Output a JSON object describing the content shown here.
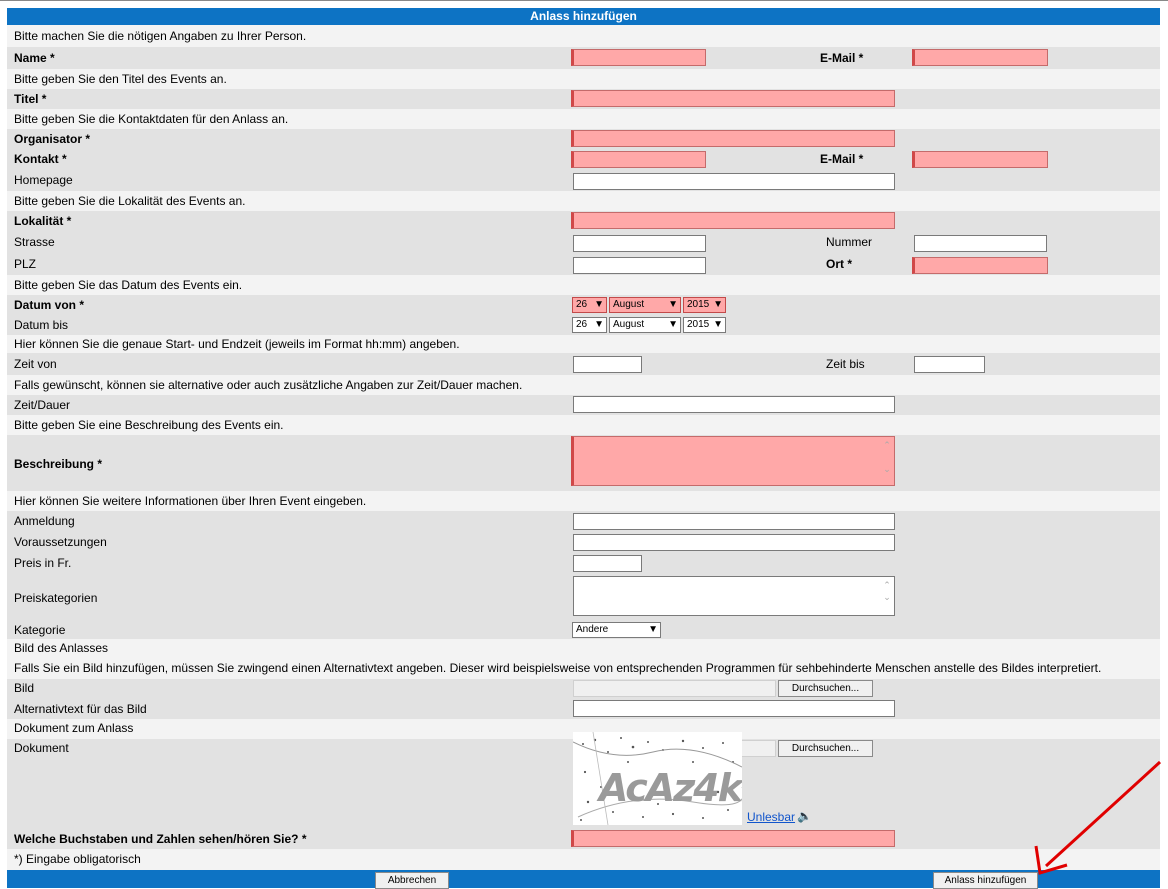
{
  "form": {
    "title": "Anlass hinzufügen",
    "rows": {
      "intro_person": "Bitte machen Sie die nötigen Angaben zu Ihrer Person.",
      "name": "Name *",
      "email1": "E-Mail *",
      "intro_title": "Bitte geben Sie den Titel des Events an.",
      "titel": "Titel *",
      "intro_contact": "Bitte geben Sie die Kontaktdaten für den Anlass an.",
      "organisator": "Organisator *",
      "kontakt": "Kontakt *",
      "email2": "E-Mail *",
      "homepage": "Homepage",
      "intro_location": "Bitte geben Sie die Lokalität des Events an.",
      "lokalitaet": "Lokalität *",
      "strasse": "Strasse",
      "nummer": "Nummer",
      "plz": "PLZ",
      "ort": "Ort *",
      "intro_date": "Bitte geben Sie das Datum des Events ein.",
      "datum_von": "Datum von *",
      "datum_bis": "Datum bis",
      "intro_time": "Hier können Sie die genaue Start- und Endzeit (jeweils im Format hh:mm) angeben.",
      "zeit_von": "Zeit von",
      "zeit_bis": "Zeit bis",
      "intro_duration": "Falls gewünscht, können sie alternative oder auch zusätzliche Angaben zur Zeit/Dauer machen.",
      "zeit_dauer": "Zeit/Dauer",
      "intro_description": "Bitte geben Sie eine Beschreibung des Events ein.",
      "beschreibung": "Beschreibung *",
      "intro_info": "Hier können Sie weitere Informationen über Ihren Event eingeben.",
      "anmeldung": "Anmeldung",
      "voraussetzungen": "Voraussetzungen",
      "preis": "Preis in Fr.",
      "preiskategorien": "Preiskategorien",
      "kategorie": "Kategorie",
      "bild_heading": "Bild des Anlasses",
      "bild_note": "Falls Sie ein Bild hinzufügen, müssen Sie zwingend einen Alternativtext angeben. Dieser wird beispielsweise von entsprechenden Programmen für sehbehinderte Menschen anstelle des Bildes interpretiert.",
      "bild": "Bild",
      "alt_text": "Alternativtext für das Bild",
      "dokument_heading": "Dokument zum Anlass",
      "dokument": "Dokument",
      "captcha_question": "Welche Buchstaben und Zahlen sehen/hören Sie? *",
      "required_note": "*) Eingabe obligatorisch"
    },
    "date_from": {
      "day": "26",
      "month": "August",
      "year": "2015"
    },
    "date_to": {
      "day": "26",
      "month": "August",
      "year": "2015"
    },
    "kategorie_value": "Andere",
    "browse_label": "Durchsuchen...",
    "captcha": {
      "text": "AcAz4k",
      "unreadable_link": "Unlesbar"
    },
    "buttons": {
      "cancel": "Abbrechen",
      "submit": "Anlass hinzufügen"
    }
  },
  "colors": {
    "header_blue": "#0d73c4",
    "required_field": "#ffa8a8",
    "row_grey": "#e2e2e2",
    "annotation_arrow": "#e00000"
  }
}
